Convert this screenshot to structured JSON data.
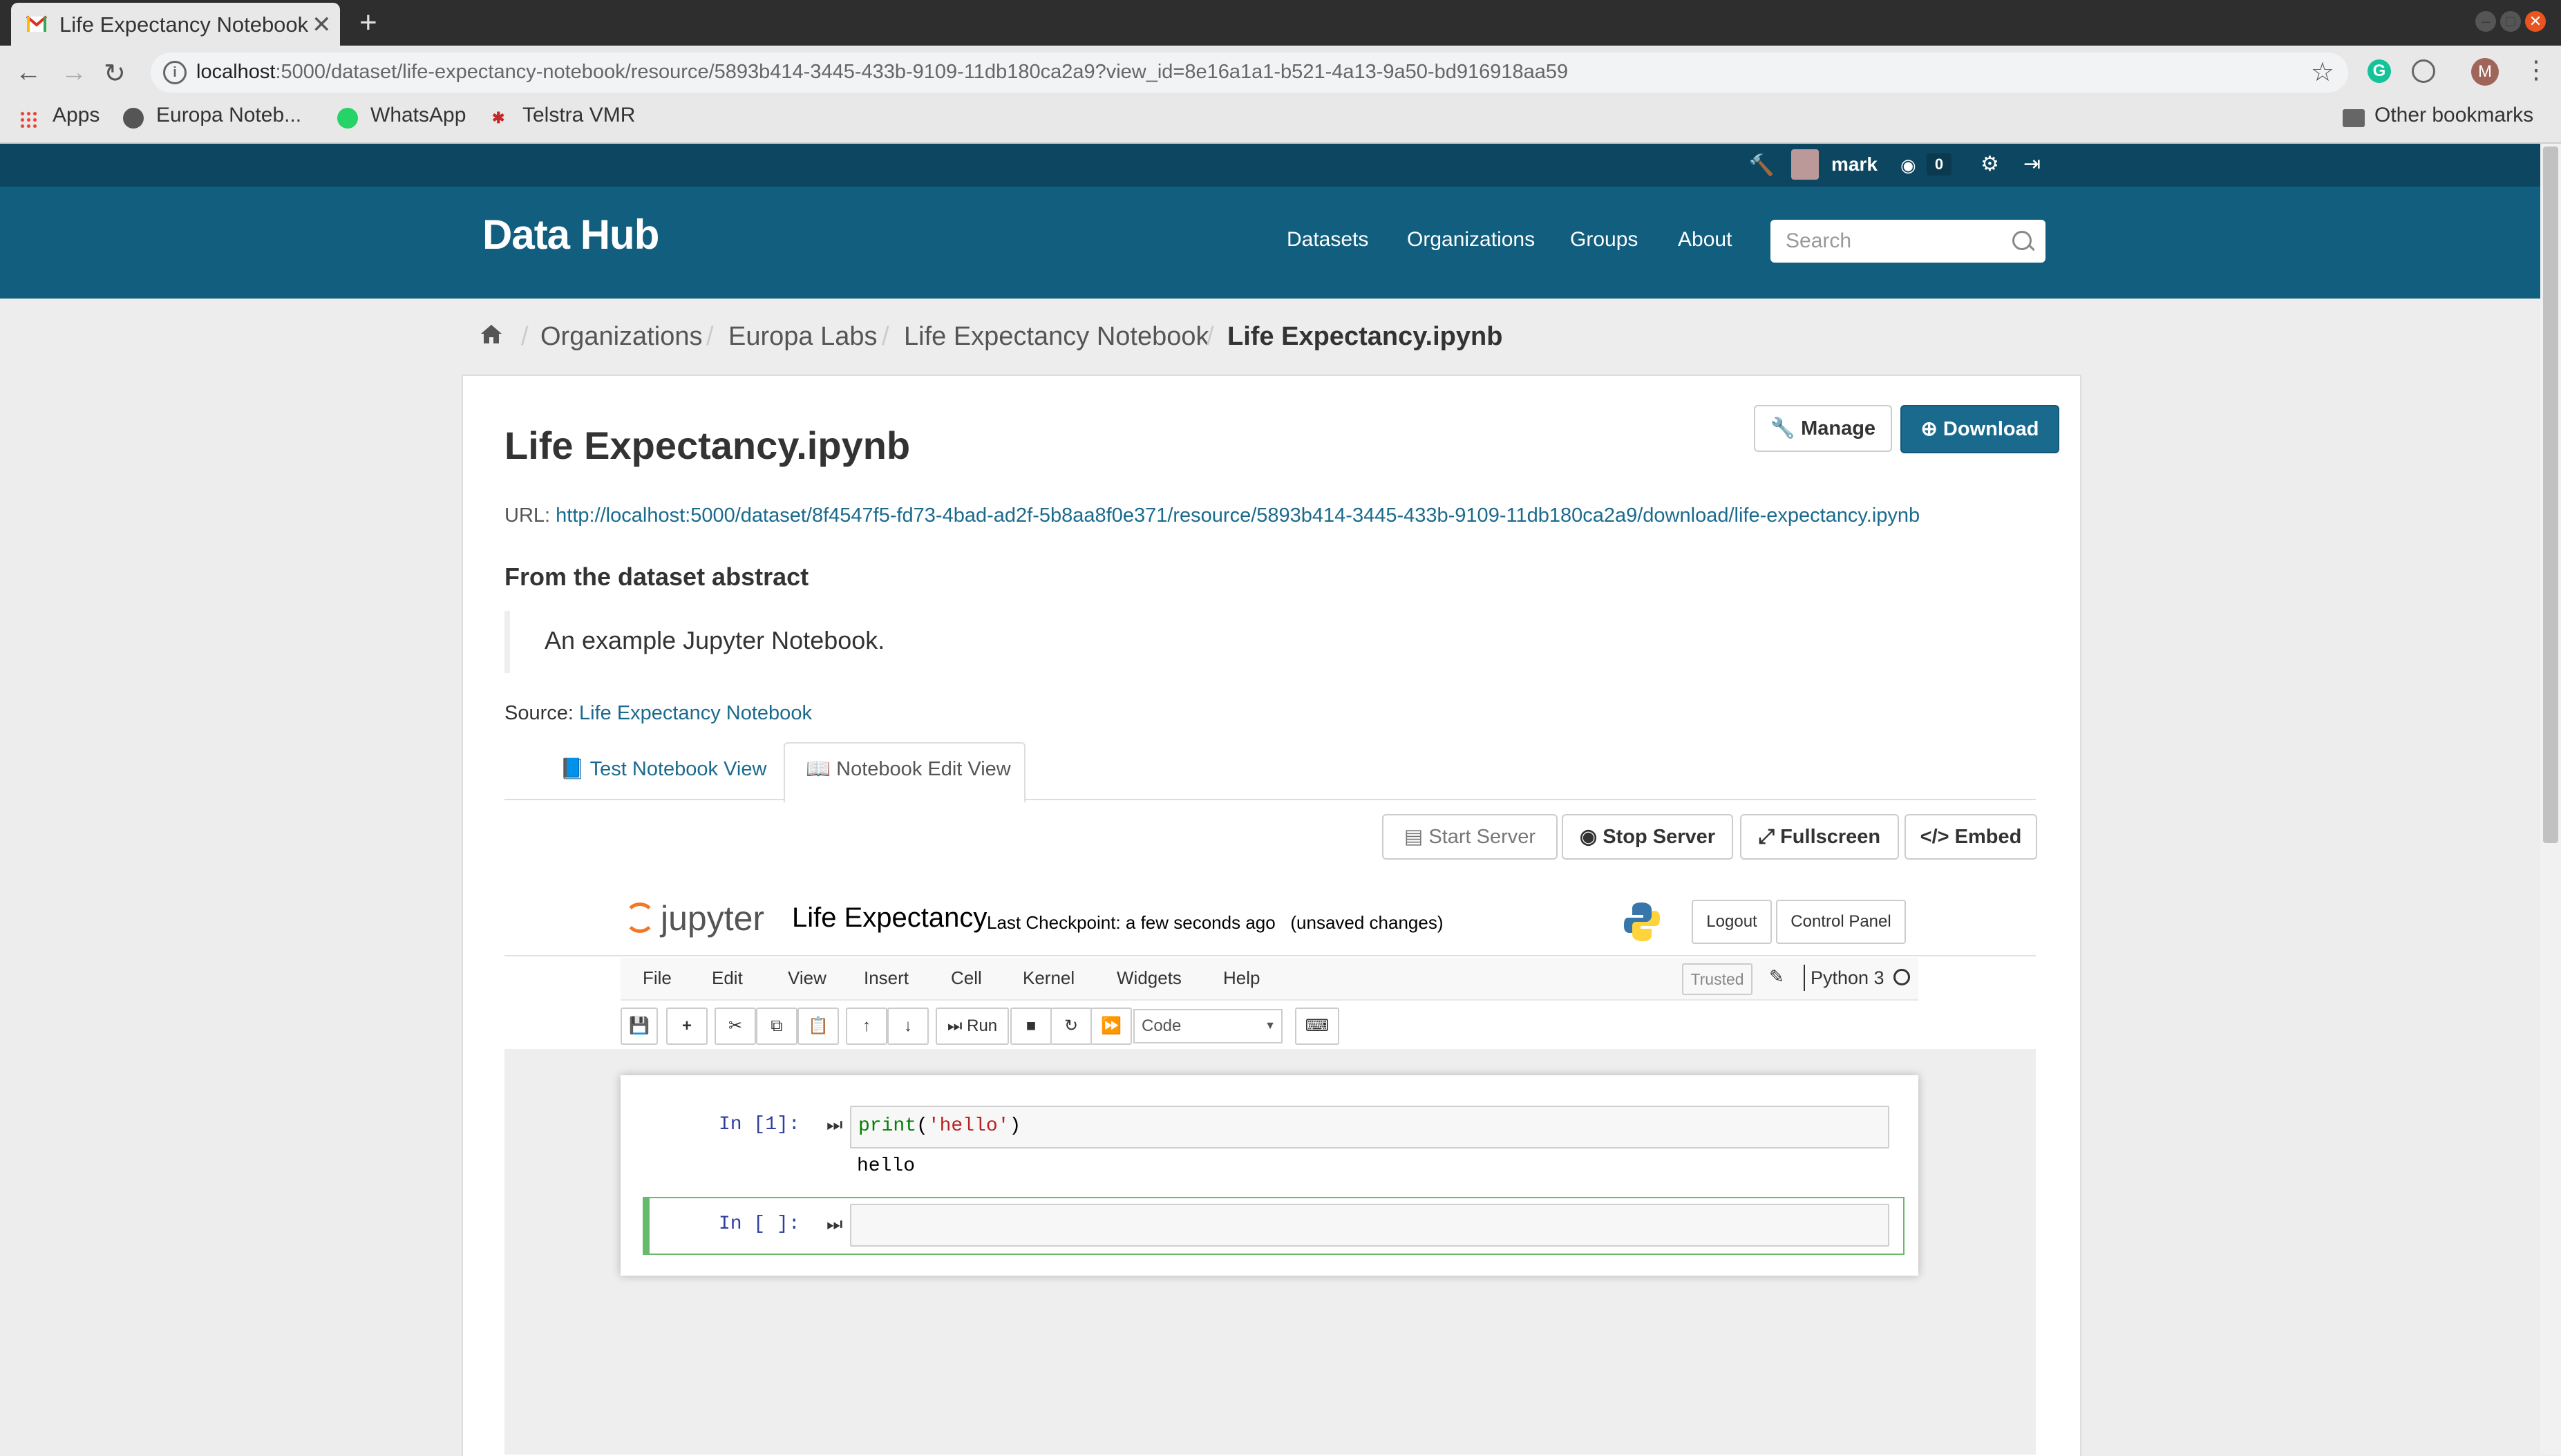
{
  "browser": {
    "tab_title": "Life Expectancy Notebook",
    "new_tab": "+",
    "url_host": "localhost",
    "url_rest": ":5000/dataset/life-expectancy-notebook/resource/5893b414-3445-433b-9109-11db180ca2a9?view_id=8e16a1a1-b521-4a13-9a50-bd916918aa59",
    "profile_initial": "M",
    "bookmarks": [
      "Apps",
      "Europa Noteb...",
      "WhatsApp",
      "Telstra VMR"
    ],
    "other_bookmarks": "Other bookmarks"
  },
  "account": {
    "username": "mark",
    "activity_count": "0"
  },
  "site": {
    "brand": "Data Hub",
    "nav": [
      "Datasets",
      "Organizations",
      "Groups",
      "About"
    ],
    "search_placeholder": "Search"
  },
  "breadcrumb": [
    "Organizations",
    "Europa Labs",
    "Life Expectancy Notebook",
    "Life Expectancy.ipynb"
  ],
  "resource": {
    "title": "Life Expectancy.ipynb",
    "manage_label": "Manage",
    "download_label": "Download",
    "url_label": "URL:",
    "url": "http://localhost:5000/dataset/8f4547f5-fd73-4bad-ad2f-5b8aa8f0e371/resource/5893b414-3445-433b-9109-11db180ca2a9/download/life-expectancy.ipynb",
    "abstract_heading": "From the dataset abstract",
    "abstract": "An example Jupyter Notebook.",
    "source_label": "Source:",
    "source_link": "Life Expectancy Notebook"
  },
  "view_tabs": [
    "Test Notebook View",
    "Notebook Edit View"
  ],
  "view_actions": [
    "Start Server",
    "Stop Server",
    "Fullscreen",
    "Embed"
  ],
  "jupyter": {
    "logo_text": "jupyter",
    "notebook_name": "Life Expectancy",
    "checkpoint": "Last Checkpoint: a few seconds ago",
    "unsaved": "(unsaved changes)",
    "logout": "Logout",
    "control_panel": "Control Panel",
    "menu": [
      "File",
      "Edit",
      "View",
      "Insert",
      "Cell",
      "Kernel",
      "Widgets",
      "Help"
    ],
    "trusted": "Trusted",
    "kernel": "Python 3",
    "run_label": "Run",
    "cell_type": "Code",
    "cells": [
      {
        "prompt": "In [1]:",
        "code_fn": "print",
        "code_open": "(",
        "code_str": "'hello'",
        "code_close": ")",
        "output": "hello"
      },
      {
        "prompt": "In [ ]:",
        "code": ""
      }
    ]
  },
  "colors": {
    "masthead": "#115e7e",
    "masthead_top": "#0d4660",
    "primary_button": "#1a6a8d",
    "link": "#1a6a8d"
  }
}
